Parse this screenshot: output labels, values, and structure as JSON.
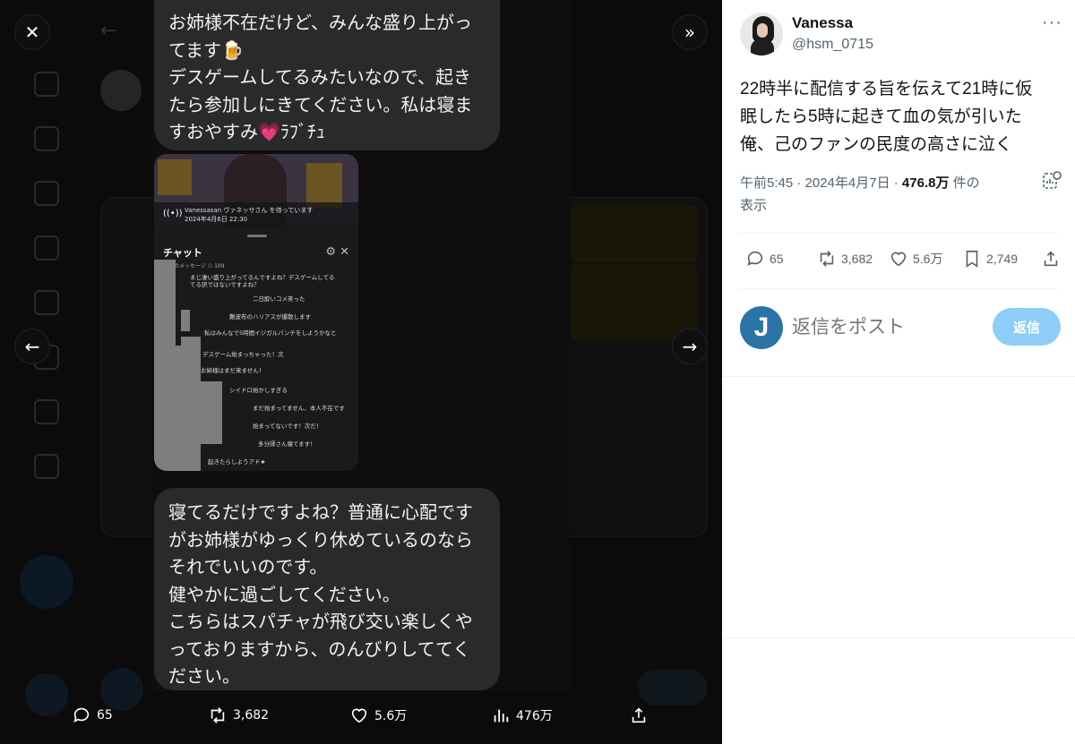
{
  "viewer": {
    "bubble_top": "お姉様不在だけど、みんな盛り上がっ\nてます🍺\nデスゲームしてるみたいなので、起き\nたら参加しにきてください。私は寝ま\nすおやすみ💗ﾗﾌﾞﾁｭ",
    "bubble_bottom": "寝てるだけですよね？普通に心配です\nがお姉様がゆっくり休めているのなら\nそれでいいのです。\n健やかに過ごしてください。\nこちらはスパチャが飛び交い楽しくや\nっておりますから、のんびりしててく\nださい。",
    "chat": {
      "live_text": "Vanessasan ヴァネッサさん を待っています",
      "live_date": "2024年4月6日 22:30",
      "title": "チャット",
      "subtitle": "上位のメッセージ ⚇ 109",
      "lines": [
        "まじ凄い盛り上がってるんですよね？デスゲームしてる",
        "てる訳ではないですよね？",
        "二日酔いコメ笑った",
        "難波布のハリアスが爆散します",
        "私はみんなで5時間イジガルパンチをしようかなと",
        "いかい",
        "デスゲーム始まっちゃった！次",
        "お姉様はまだ来ません！",
        "シイドロ始かしすぎる",
        "まだ始まってません、本人不在です",
        "始まってないです！次だ！",
        "多分師さん寝てます！",
        "起きたらしようアド★"
      ]
    },
    "stats": {
      "replies": "65",
      "retweets": "3,682",
      "likes": "5.6万",
      "views": "476万"
    },
    "icons": [
      "close-icon",
      "forward-icon",
      "prev-icon",
      "next-icon"
    ]
  },
  "tweet": {
    "author_name": "Vanessa",
    "author_handle": "@hsm_0715",
    "more": "···",
    "text": "22時半に配信する旨を伝えて21時に仮\n眠したら5時に起きて血の気が引いた\n俺、己のファンの民度の高さに泣く",
    "time": "午前5:45 · 2024年4月7日 · ",
    "views_count": "476.8万",
    "views_label": " 件の",
    "views_label2": "表示",
    "replies": "65",
    "retweets": "3,682",
    "likes": "5.6万",
    "bookmarks": "2,749",
    "reply_avatar_letter": "J",
    "reply_placeholder": "返信をポスト",
    "reply_button": "返信"
  },
  "colors": {
    "accent": "#1d9bf0",
    "reply_button": "#8ecdf7",
    "muted": "#536471"
  }
}
